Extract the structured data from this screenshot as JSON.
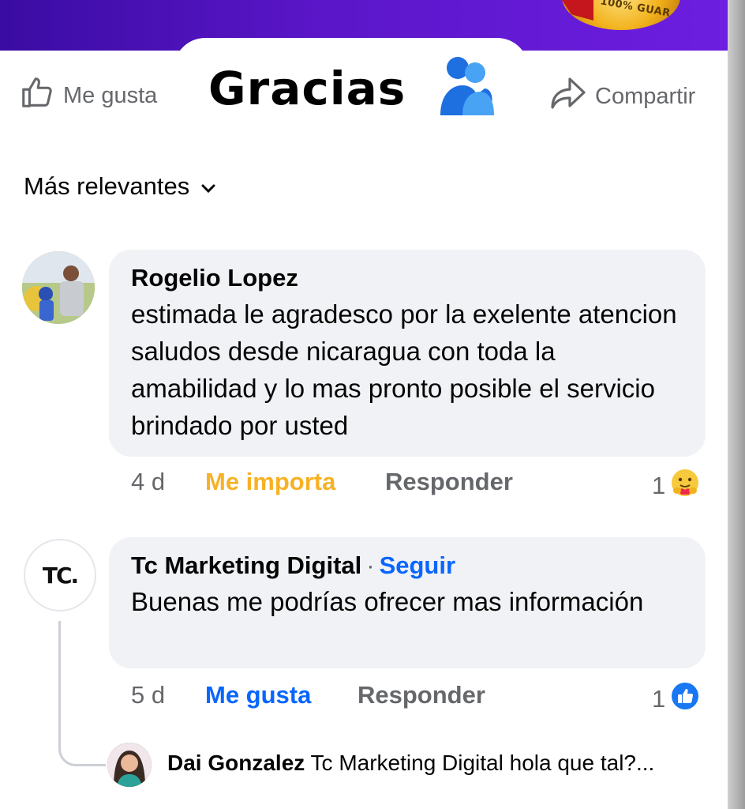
{
  "banner": {
    "badge_text": "100% GUAR"
  },
  "actions": {
    "like_label": "Me gusta",
    "title": "Gracias",
    "share_label": "Compartir"
  },
  "sort": {
    "label": "Más relevantes"
  },
  "comments": [
    {
      "author": "Rogelio Lopez",
      "text": "estimada le agradesco por la exelente atencion  saludos desde nicaragua  con toda la amabilidad y lo mas pronto posible el servicio brindado por usted",
      "time": "4 d",
      "reaction_label": "Me importa",
      "reply_label": "Responder",
      "reaction_count": "1",
      "reaction_icon": "care-emoji-icon"
    },
    {
      "author": "Tc Marketing Digital",
      "follow_separator": "·",
      "follow_label": "Seguir",
      "avatar_text": "TC.",
      "text": "Buenas me podrías ofrecer mas información",
      "time": "5 d",
      "reaction_label": "Me gusta",
      "reply_label": "Responder",
      "reaction_count": "1",
      "reaction_icon": "like-reaction-icon"
    }
  ],
  "reply_preview": {
    "author": "Dai Gonzalez",
    "text": "Tc Marketing Digital hola que tal?..."
  },
  "colors": {
    "accent": "#0866ff",
    "care": "#f7b125",
    "meta": "#65676b",
    "bubble": "#f0f2f5"
  }
}
